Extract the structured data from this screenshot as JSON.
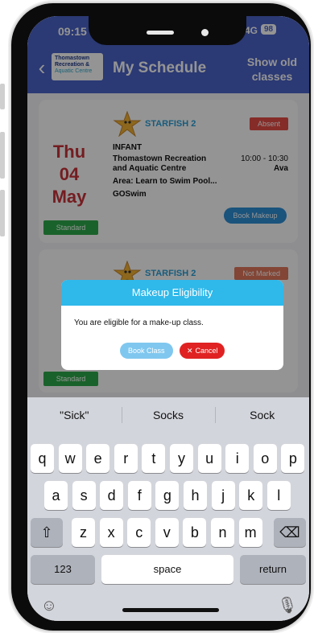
{
  "status_bar": {
    "time": "09:15",
    "network": "4G",
    "battery": "98"
  },
  "header": {
    "logo_lines": [
      "Thomastown",
      "Recreation &",
      "Aquatic Centre"
    ],
    "title": "My Schedule",
    "show_old_line1": "Show old",
    "show_old_line2": "classes"
  },
  "cards": [
    {
      "day": "Thu",
      "date": "04",
      "month": "May",
      "badge": "Standard",
      "class_name": "STARFISH 2",
      "status": "Absent",
      "level": "INFANT",
      "venue_line1": "Thomastown Recreation",
      "venue_line2": "and Aquatic Centre",
      "time": "10:00 - 10:30",
      "instructor": "Ava",
      "area": "Area: Learn to Swim Pool...",
      "provider": "GOSwim",
      "book_makeup": "Book Makeup"
    },
    {
      "class_name": "STARFISH 2",
      "status": "Not Marked",
      "badge": "Standard"
    }
  ],
  "modal": {
    "title": "Makeup Eligibility",
    "message": "You are eligible for a make-up class.",
    "book_label": "Book Class",
    "cancel_label": "Cancel"
  },
  "keyboard": {
    "suggestions": [
      "\"Sick\"",
      "Socks",
      "Sock"
    ],
    "row1": [
      "q",
      "w",
      "e",
      "r",
      "t",
      "y",
      "u",
      "i",
      "o",
      "p"
    ],
    "row2": [
      "a",
      "s",
      "d",
      "f",
      "g",
      "h",
      "j",
      "k",
      "l"
    ],
    "row3": [
      "z",
      "x",
      "c",
      "v",
      "b",
      "n",
      "m"
    ],
    "numbers_label": "123",
    "space_label": "space",
    "return_label": "return"
  },
  "colors": {
    "header": "#4a63c9",
    "date_red": "#c9333a",
    "modal_header": "#2fb8ea",
    "cancel_red": "#e02222",
    "standard_green": "#2eaa4a"
  }
}
